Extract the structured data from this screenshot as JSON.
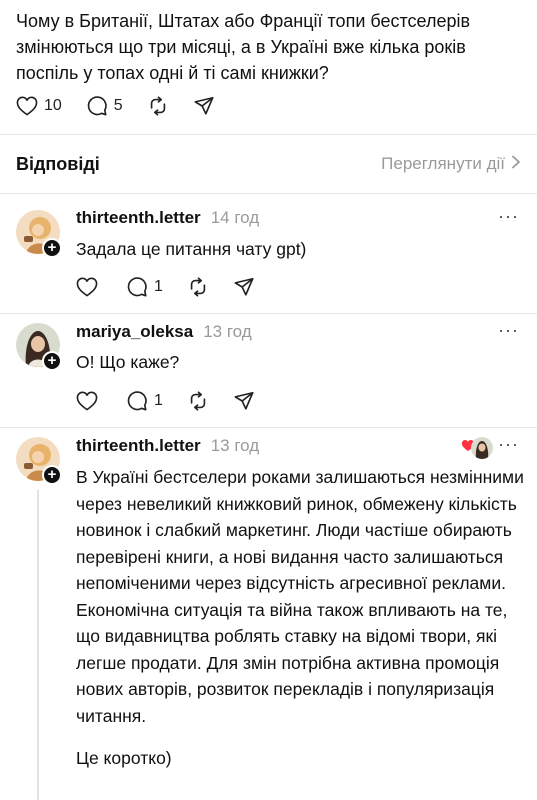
{
  "post": {
    "text": "Чому в Британії, Штатах або Франції топи бестселерів змінюються що три місяці, а в Україні вже кілька років поспіль у топах одні й ті самі книжки?",
    "likes": "10",
    "comments": "5"
  },
  "replies": {
    "title": "Відповіді",
    "view_activity": "Переглянути дії"
  },
  "comments": [
    {
      "username": "thirteenth.letter",
      "time": "14 год",
      "text": "Задала це питання чату gpt)",
      "comments": "1",
      "more": "···"
    },
    {
      "username": "mariya_oleksa",
      "time": "13 год",
      "text": "О! Що каже?",
      "comments": "1",
      "more": "···"
    },
    {
      "username": "thirteenth.letter",
      "time": "13 год",
      "paragraph1": "В Україні бестселери роками залишаються незмінними через невеликий книжковий ринок, обмежену кількість новинок і слабкий маркетинг. Люди частіше обирають перевірені книги, а нові видання часто залишаються непоміченими через відсутність агресивної реклами. Економічна ситуація та війна також впливають на те, що видавництва роблять ставку на відомі твори, які легше продати. Для змін потрібна активна промоція нових авторів, розвиток перекладів і популяризація читання.",
      "paragraph2": "Це коротко)",
      "more": "···"
    }
  ],
  "colors": {
    "text": "#111111",
    "muted": "#9a9a9a",
    "heart_red": "#ff3040",
    "divider": "#e6e6e6"
  },
  "icons": [
    "heart-icon",
    "comment-icon",
    "repost-icon",
    "share-icon",
    "chevron-right-icon",
    "more-icon",
    "plus-icon"
  ]
}
